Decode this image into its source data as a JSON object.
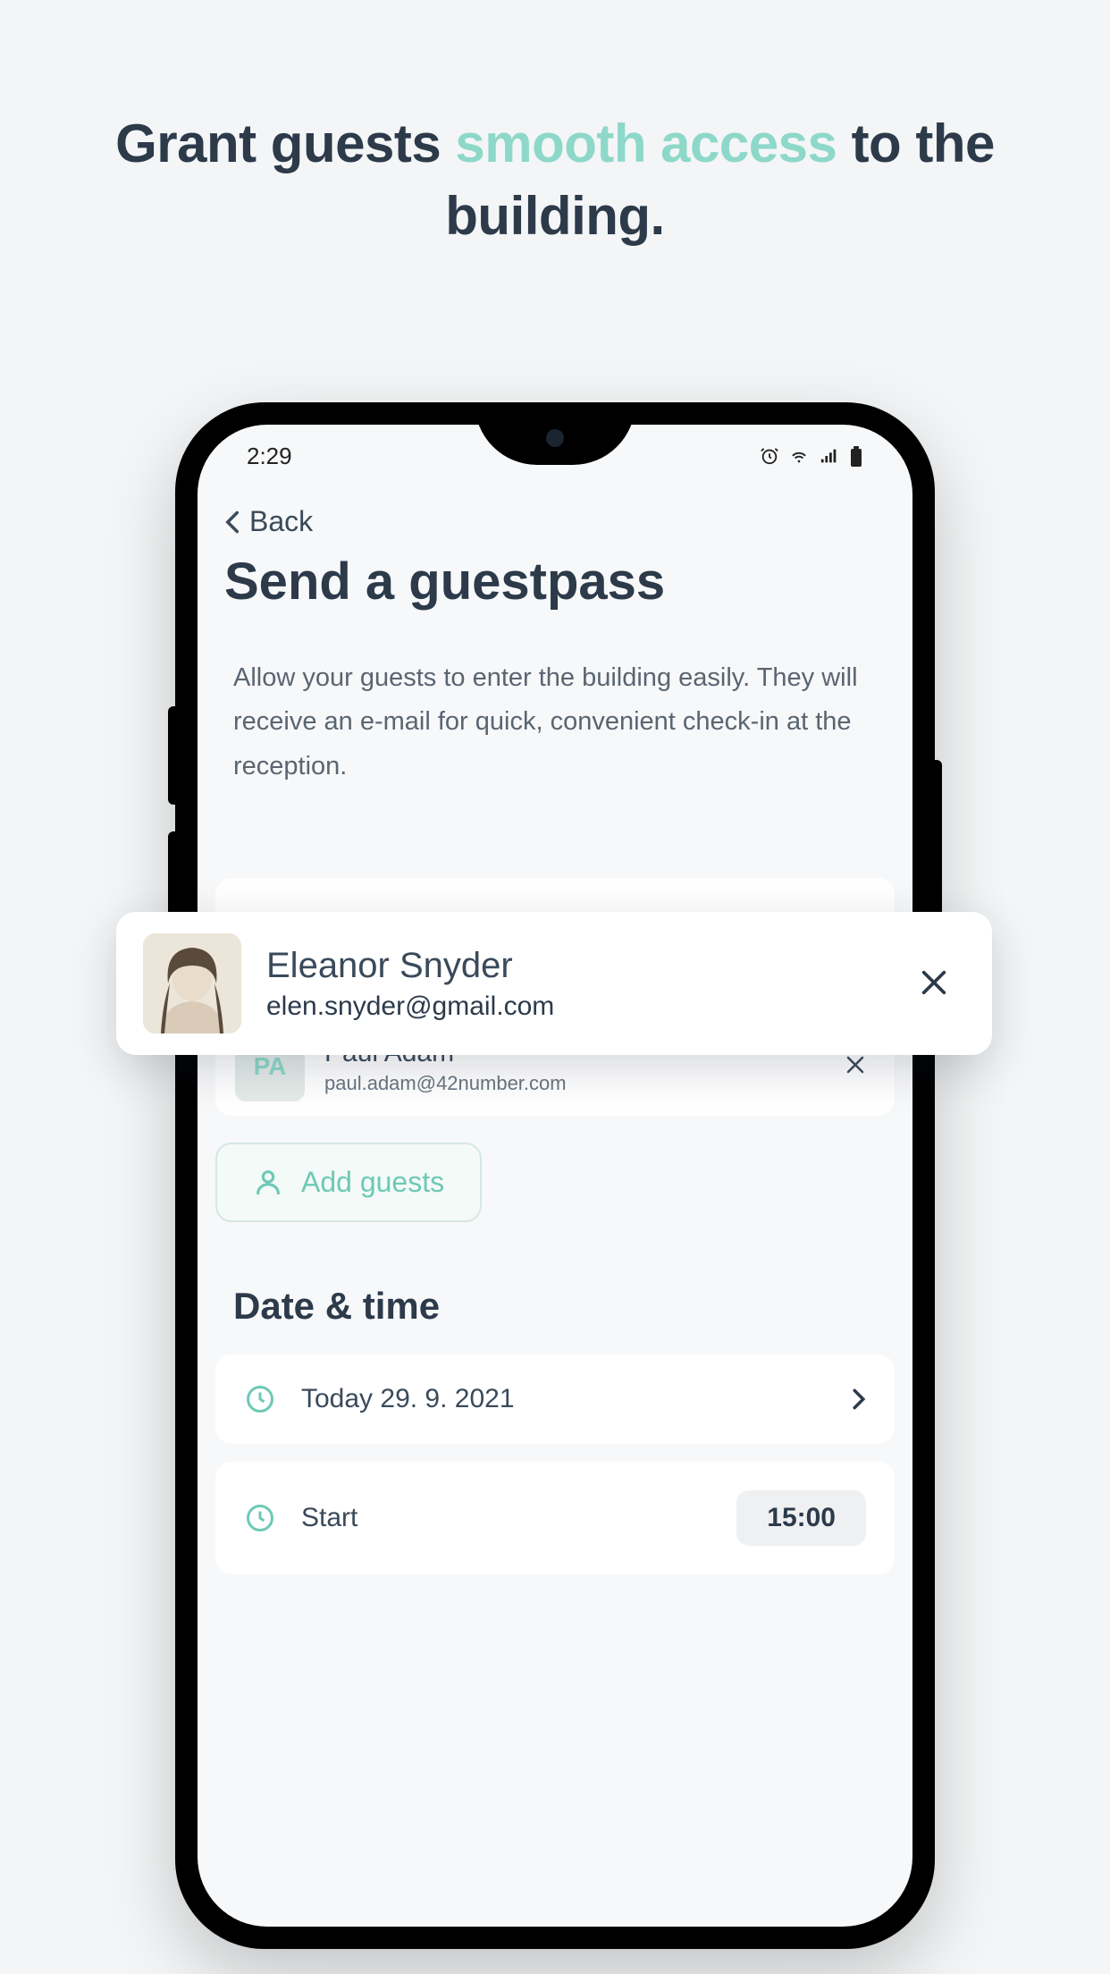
{
  "headline": {
    "part1": "Grant guests ",
    "accent": "smooth access",
    "part2": " to the building."
  },
  "status": {
    "time": "2:29"
  },
  "nav": {
    "back": "Back"
  },
  "page": {
    "title": "Send a guestpass",
    "description": "Allow your guests to enter the building easily. They will receive an e-mail for quick, convenient check-in at the reception."
  },
  "floating_guest": {
    "name": "Eleanor Snyder",
    "email": "elen.snyder@gmail.com"
  },
  "guests": [
    {
      "name": "",
      "email": "elen.snyder@gmail.com",
      "email2": "elen.snyder@gmail.com",
      "avatar_type": "photo"
    },
    {
      "name": "Paul Adam",
      "email": "paul.adam@42number.com",
      "initials": "PA",
      "avatar_type": "initials"
    }
  ],
  "add_guests_label": "Add guests",
  "datetime": {
    "section_title": "Date & time",
    "date_value": "Today 29. 9. 2021",
    "start_label": "Start",
    "start_value": "15:00"
  }
}
